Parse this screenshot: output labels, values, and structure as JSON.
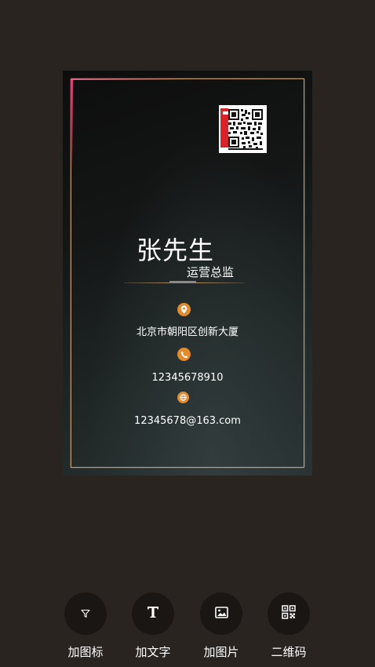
{
  "card": {
    "name": "张先生",
    "title": "运营总监",
    "address": "北京市朝阳区创新大厦",
    "phone": "12345678910",
    "email": "12345678@163.com"
  },
  "toolbar": {
    "items": [
      {
        "label": "加图标",
        "icon": "filter-icon"
      },
      {
        "label": "加文字",
        "icon": "text-icon"
      },
      {
        "label": "加图片",
        "icon": "image-icon"
      },
      {
        "label": "二维码",
        "icon": "qrcode-icon"
      }
    ]
  },
  "colors": {
    "background": "#2a2421",
    "frame": "#c9a074",
    "icon_accent": "#e58a2c",
    "tool_circle": "#1a1614"
  }
}
